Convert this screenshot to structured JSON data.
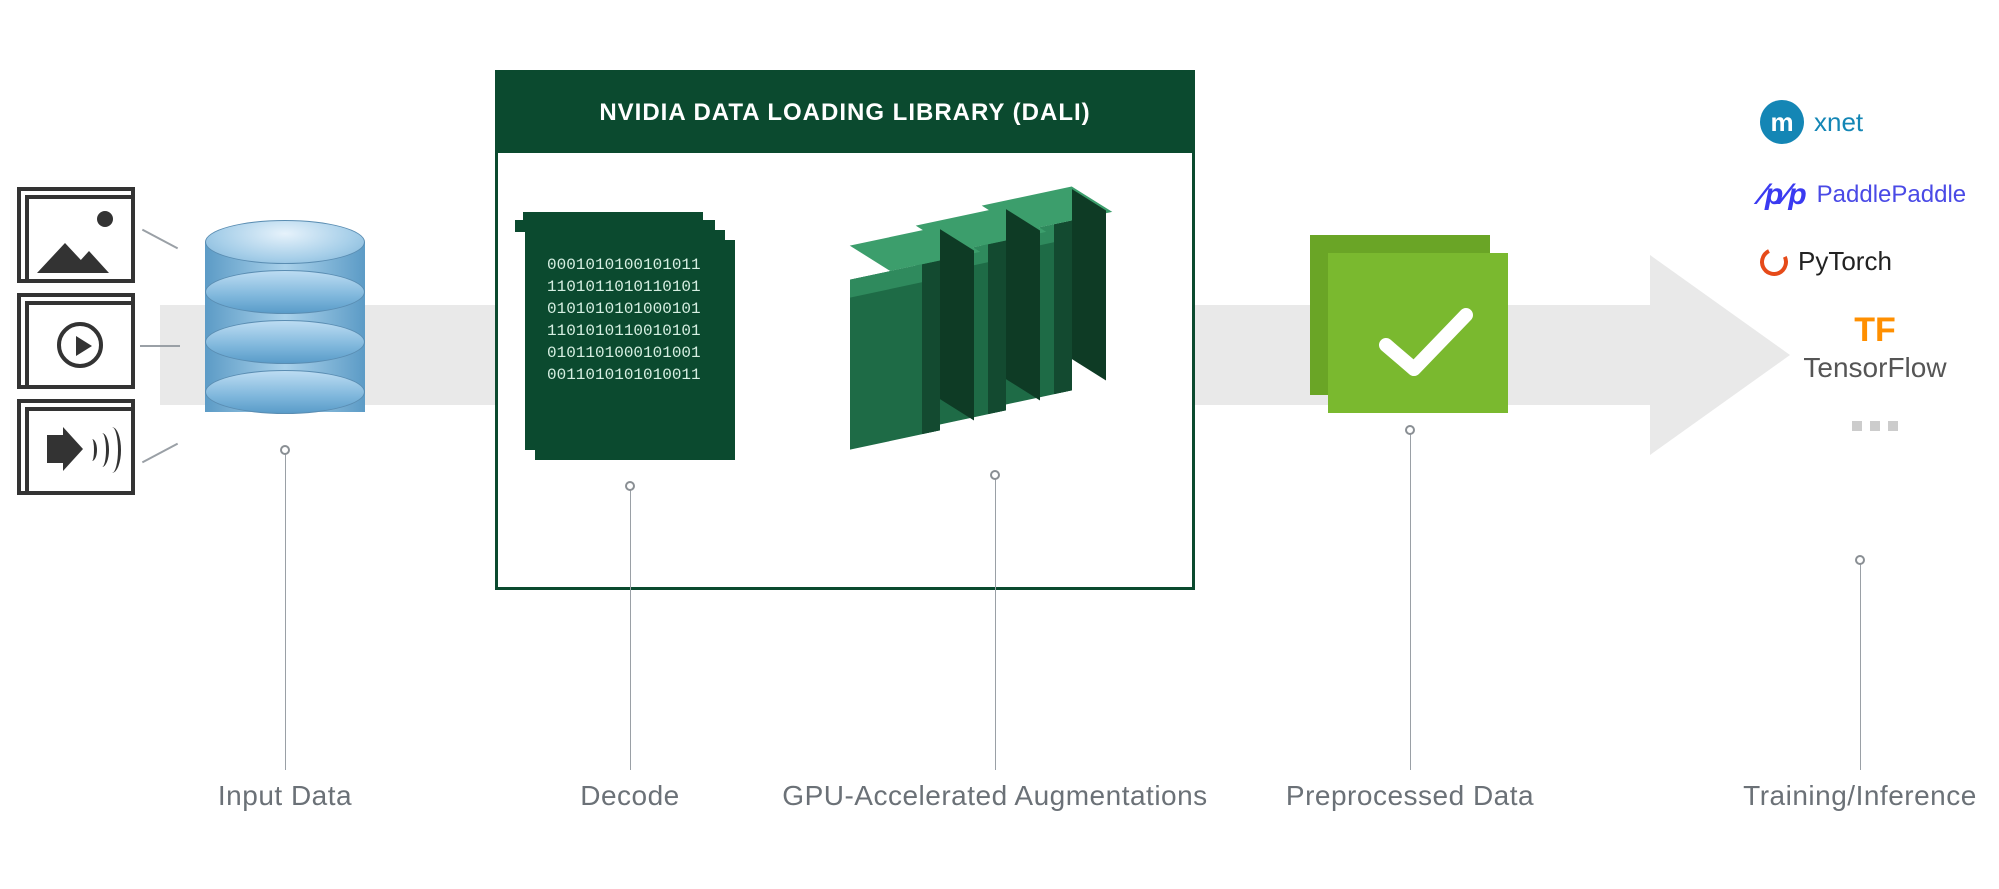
{
  "diagram": {
    "title": "NVIDIA DATA LOADING LIBRARY (DALI)",
    "input_types_icons": [
      "image-icon",
      "video-icon",
      "audio-icon"
    ],
    "decode_bits": "0001010100101011\n1101011010110101\n0101010101000101\n1101010110010101\n0101101000101001\n0011010101010011",
    "frameworks": {
      "mxnet": {
        "badge": "m",
        "label": "xnet"
      },
      "paddle": {
        "logo": "pp",
        "label": "PaddlePaddle"
      },
      "pytorch": {
        "label": "PyTorch"
      },
      "tensorflow": {
        "logo": "TF",
        "label": "TensorFlow"
      }
    },
    "labels": {
      "input_data": "Input Data",
      "decode": "Decode",
      "gpu_aug": "GPU-Accelerated Augmentations",
      "preprocessed": "Preprocessed Data",
      "training": "Training/Inference"
    }
  }
}
